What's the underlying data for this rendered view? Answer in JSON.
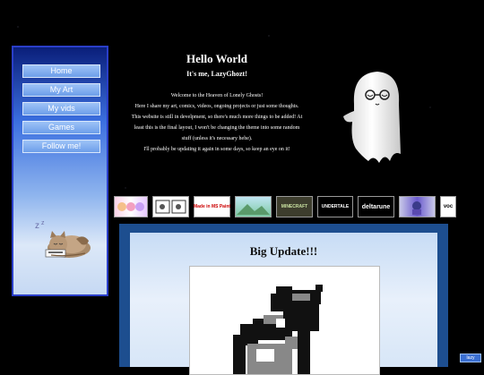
{
  "nav": {
    "items": [
      {
        "label": "Home"
      },
      {
        "label": "My Art"
      },
      {
        "label": "My vids"
      },
      {
        "label": "Games"
      },
      {
        "label": "Follow me!"
      }
    ]
  },
  "intro": {
    "title": "Hello World",
    "subtitle": "It's me, LazyGhozt!",
    "lines": [
      "Welcome to the Heaven of Lonely Ghosts!",
      "Here I share my art, comics, videos, ongoing projects or just some thoughts.",
      "This website is still in develpment, so there's much more things to be added! At",
      "least this is the final layout, I won't be changing the theme into some random",
      "stuff (unless it's necessary hehe).",
      "I'll probably be updating it again in some days, so keep an eye on it!"
    ]
  },
  "site_buttons": [
    {
      "label": "",
      "icon": "anime-faces-button"
    },
    {
      "label": "",
      "icon": "comic-button"
    },
    {
      "label": "",
      "icon": "made-with-paint-button",
      "text": "Made in MS Paint"
    },
    {
      "label": "",
      "icon": "landscape-button"
    },
    {
      "label": "MINECRAFT",
      "icon": "minecraft-button"
    },
    {
      "label": "UNDERTALE",
      "icon": "undertale-button"
    },
    {
      "label": "deltarune",
      "icon": "deltarune-button"
    },
    {
      "label": "",
      "icon": "character-button"
    },
    {
      "label": "voc",
      "icon": "vocaloid-button"
    }
  ],
  "update": {
    "title": "Big Update!!!"
  },
  "badges": {
    "corner": "lazy"
  },
  "colors": {
    "background": "#000000",
    "sidebar_border": "#2a3ec8",
    "update_frame": "#1d4e8f",
    "nav_button": "#7aa8ee"
  }
}
